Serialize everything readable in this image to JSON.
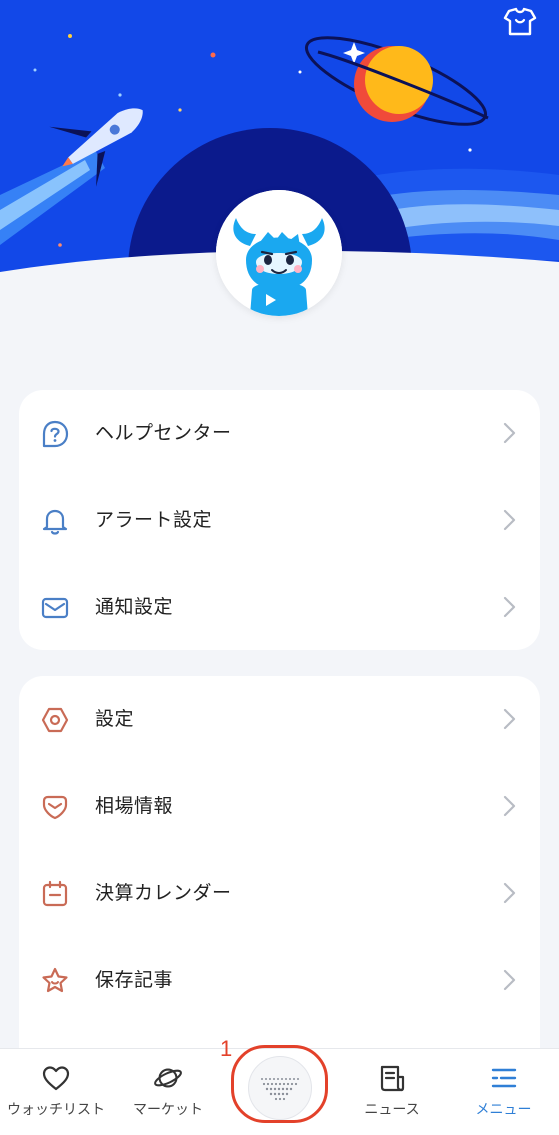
{
  "colors": {
    "sky": "#1248e8",
    "accent": "#2f7fd6",
    "menu_group1_icon": "#4a7fc6",
    "menu_group2_icon": "#c96b56"
  },
  "header": {
    "shirt_icon": "tshirt-icon"
  },
  "menu_group1": [
    {
      "label": "ヘルプセンター",
      "icon": "help-circle-icon"
    },
    {
      "label": "アラート設定",
      "icon": "bell-icon"
    },
    {
      "label": "通知設定",
      "icon": "mail-icon"
    }
  ],
  "menu_group2": [
    {
      "label": "設定",
      "icon": "hex-settings-icon"
    },
    {
      "label": "相場情報",
      "icon": "market-info-icon"
    },
    {
      "label": "決算カレンダー",
      "icon": "calendar-icon"
    },
    {
      "label": "保存記事",
      "icon": "star-icon"
    }
  ],
  "tabbar": [
    {
      "label": "ウォッチリスト",
      "icon": "heart-icon"
    },
    {
      "label": "マーケット",
      "icon": "planet-icon"
    },
    {
      "label": "",
      "icon": "center-logo-icon"
    },
    {
      "label": "ニュース",
      "icon": "news-icon"
    },
    {
      "label": "メニュー",
      "icon": "menu-list-icon",
      "active": true
    }
  ],
  "annotation": {
    "number": "1"
  }
}
